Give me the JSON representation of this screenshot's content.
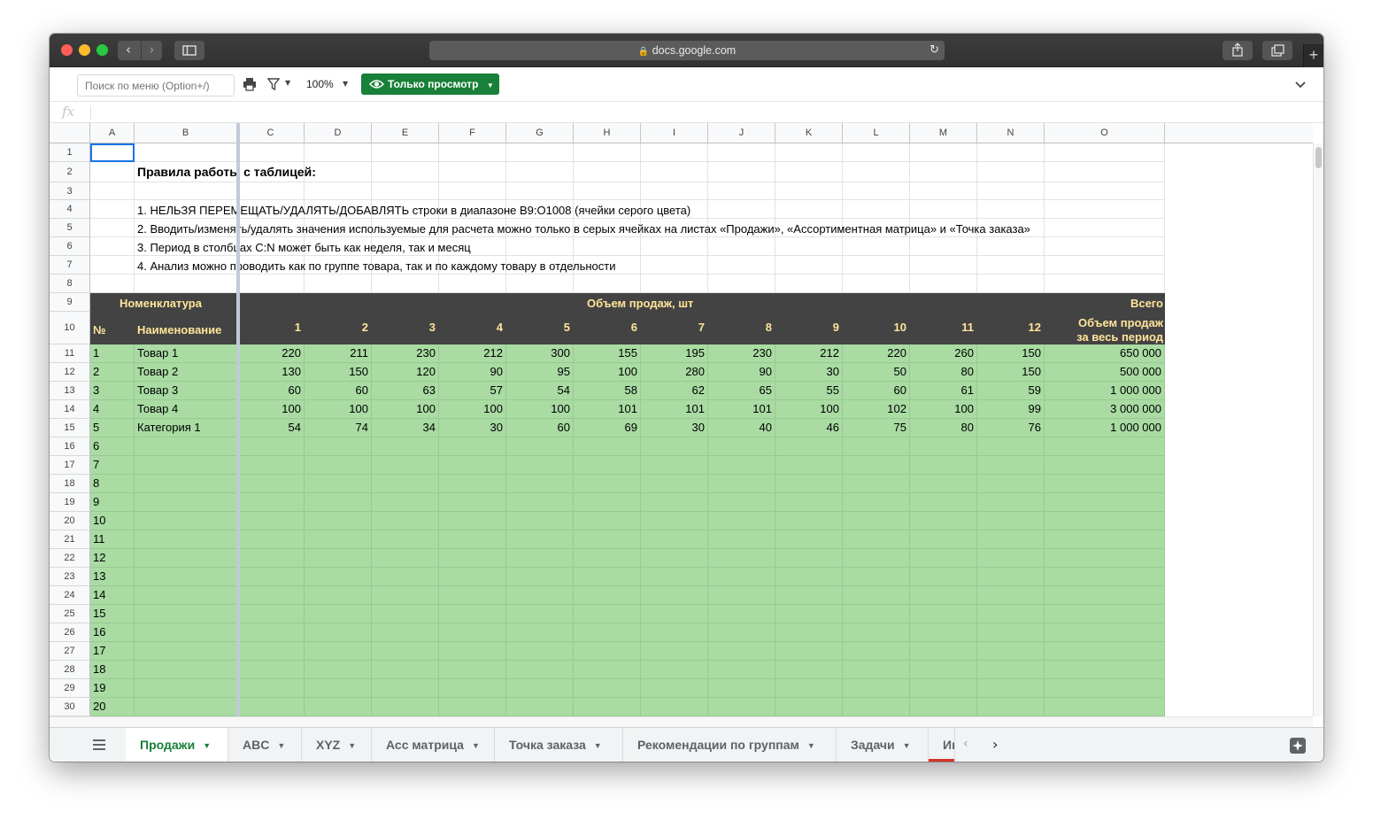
{
  "browser": {
    "url": "docs.google.com",
    "back_icon": "chevron-left-icon",
    "forward_icon": "chevron-right-icon",
    "sidebar_icon": "sidebar-icon",
    "share_icon": "share-icon",
    "tabs_icon": "tabs-icon",
    "newtab_label": "+"
  },
  "toolbar": {
    "menu_search_placeholder": "Поиск по меню (Option+/)",
    "zoom": "100%",
    "view_only_label": "Только просмотр"
  },
  "formula_bar": {
    "fx": "fx",
    "value": ""
  },
  "columns": [
    "A",
    "B",
    "C",
    "D",
    "E",
    "F",
    "G",
    "H",
    "I",
    "J",
    "K",
    "L",
    "M",
    "N",
    "O"
  ],
  "rows": [
    "1",
    "2",
    "3",
    "4",
    "5",
    "6",
    "7",
    "8",
    "9",
    "10",
    "11",
    "12",
    "13",
    "14",
    "15",
    "16",
    "17",
    "18",
    "19",
    "20",
    "21",
    "22",
    "23",
    "24",
    "25",
    "26",
    "27",
    "28",
    "29",
    "30"
  ],
  "rules": {
    "title": "Правила работы с таблицей:",
    "items": [
      "1. НЕЛЬЗЯ ПЕРЕМЕЩАТЬ/УДАЛЯТЬ/ДОБАВЛЯТЬ строки в диапазоне B9:O1008 (ячейки серого цвета)",
      "2. Вводить/изменять/удалять значения используемые для расчета можно только в серых ячейках на листах «Продажи», «Ассортиментная матрица» и «Точка заказа»",
      "3. Период в столбцах C:N может быть как неделя, так и месяц",
      "4. Анализ можно проводить как по группе товара, так и по каждому товару в отдельности"
    ]
  },
  "table_header": {
    "nomenclature": "Номенклатура",
    "sales_volume": "Объем продаж, шт",
    "total": "Всего",
    "no": "№",
    "name": "Наименование",
    "periods": [
      "1",
      "2",
      "3",
      "4",
      "5",
      "6",
      "7",
      "8",
      "9",
      "10",
      "11",
      "12"
    ],
    "total_sub_1": "Объем продаж",
    "total_sub_2": "за весь период"
  },
  "table_rows": [
    {
      "no": "1",
      "name": "Товар 1",
      "values": [
        "220",
        "211",
        "230",
        "212",
        "300",
        "155",
        "195",
        "230",
        "212",
        "220",
        "260",
        "150"
      ],
      "total": "650 000"
    },
    {
      "no": "2",
      "name": "Товар 2",
      "values": [
        "130",
        "150",
        "120",
        "90",
        "95",
        "100",
        "280",
        "90",
        "30",
        "50",
        "80",
        "150"
      ],
      "total": "500 000"
    },
    {
      "no": "3",
      "name": "Товар 3",
      "values": [
        "60",
        "60",
        "63",
        "57",
        "54",
        "58",
        "62",
        "65",
        "55",
        "60",
        "61",
        "59"
      ],
      "total": "1 000 000"
    },
    {
      "no": "4",
      "name": "Товар 4",
      "values": [
        "100",
        "100",
        "100",
        "100",
        "100",
        "101",
        "101",
        "101",
        "100",
        "102",
        "100",
        "99"
      ],
      "total": "3 000 000"
    },
    {
      "no": "5",
      "name": "Категория 1",
      "values": [
        "54",
        "74",
        "34",
        "30",
        "60",
        "69",
        "30",
        "40",
        "46",
        "75",
        "80",
        "76"
      ],
      "total": "1 000 000"
    },
    {
      "no": "6",
      "name": "",
      "values": [],
      "total": ""
    },
    {
      "no": "7",
      "name": "",
      "values": [],
      "total": ""
    },
    {
      "no": "8",
      "name": "",
      "values": [],
      "total": ""
    },
    {
      "no": "9",
      "name": "",
      "values": [],
      "total": ""
    },
    {
      "no": "10",
      "name": "",
      "values": [],
      "total": ""
    },
    {
      "no": "11",
      "name": "",
      "values": [],
      "total": ""
    },
    {
      "no": "12",
      "name": "",
      "values": [],
      "total": ""
    },
    {
      "no": "13",
      "name": "",
      "values": [],
      "total": ""
    },
    {
      "no": "14",
      "name": "",
      "values": [],
      "total": ""
    },
    {
      "no": "15",
      "name": "",
      "values": [],
      "total": ""
    },
    {
      "no": "16",
      "name": "",
      "values": [],
      "total": ""
    },
    {
      "no": "17",
      "name": "",
      "values": [],
      "total": ""
    },
    {
      "no": "18",
      "name": "",
      "values": [],
      "total": ""
    },
    {
      "no": "19",
      "name": "",
      "values": [],
      "total": ""
    },
    {
      "no": "20",
      "name": "",
      "values": [],
      "total": ""
    }
  ],
  "sheet_tabs": [
    {
      "label": "Продажи",
      "active": true
    },
    {
      "label": "ABC",
      "active": false
    },
    {
      "label": "XYZ",
      "active": false
    },
    {
      "label": "Асс матрица",
      "active": false
    },
    {
      "label": "Точка заказа",
      "active": false
    },
    {
      "label": "Рекомендации по группам",
      "active": false
    },
    {
      "label": "Задачи",
      "active": false
    },
    {
      "label": "Ин",
      "active": false
    }
  ],
  "colors": {
    "green": "#a9dba3",
    "dark": "#434343",
    "header_text": "#ffe599",
    "accent": "#188038"
  }
}
